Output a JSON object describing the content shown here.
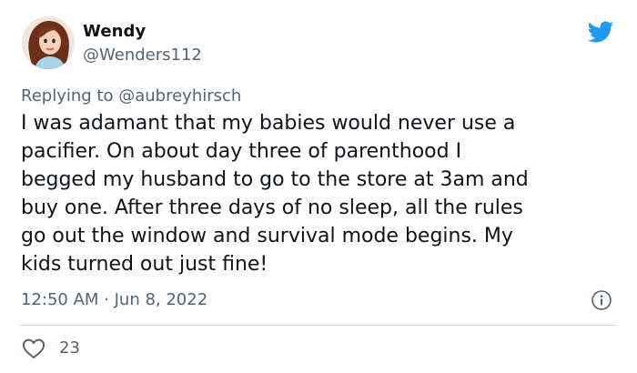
{
  "user": {
    "display_name": "Wendy",
    "handle": "@Wenders112"
  },
  "reply": {
    "prefix": "Replying to",
    "mention": "@aubreyhirsch"
  },
  "body": {
    "lines": [
      "I was adamant that my babies would never use a",
      "pacifier. On about day three of parenthood I",
      "begged my husband to go to the store at 3am and",
      "buy one. After three days of no sleep, all the rules",
      "go out the window and survival mode begins. My",
      "kids turned out just fine!"
    ]
  },
  "timestamp": "12:50 AM · Jun 8, 2022",
  "likes": {
    "count": "23"
  },
  "icons": {
    "brand": "twitter-bird-icon",
    "info": "info-icon",
    "like": "heart-icon"
  },
  "colors": {
    "brand_blue": "#1d9bf0",
    "text_primary": "#0f1419",
    "text_secondary": "#536471",
    "divider": "#cfd9de"
  }
}
